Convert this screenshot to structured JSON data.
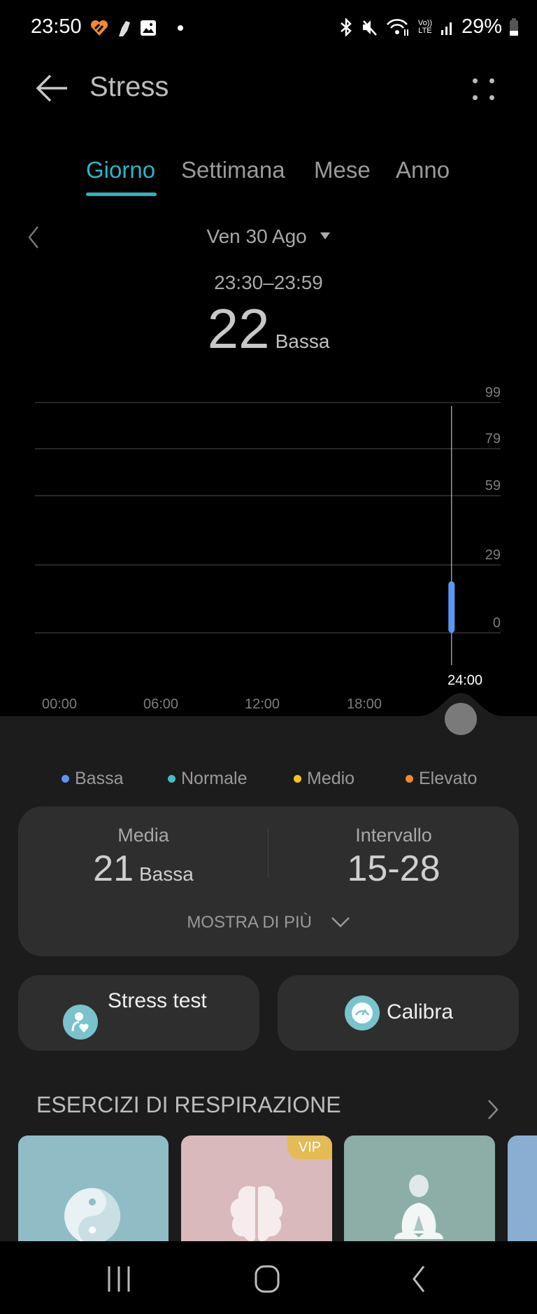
{
  "status_bar": {
    "time": "23:50",
    "battery": "29%",
    "left_icons": [
      "health-app-icon",
      "shoe-icon",
      "gallery-icon",
      "notification-dot-icon"
    ],
    "right_icons": [
      "bluetooth-icon",
      "mute-icon",
      "wifi-icon",
      "volte-icon",
      "signal-icon",
      "battery-icon"
    ],
    "volte_label": "Vo)) LTE"
  },
  "header": {
    "title": "Stress"
  },
  "tabs": [
    {
      "label": "Giorno",
      "active": true
    },
    {
      "label": "Settimana",
      "active": false
    },
    {
      "label": "Mese",
      "active": false
    },
    {
      "label": "Anno",
      "active": false
    }
  ],
  "date": {
    "label": "Ven 30 Ago"
  },
  "selection": {
    "time_range": "23:30–23:59",
    "value": "22",
    "level": "Bassa"
  },
  "chart_data": {
    "type": "bar",
    "title": "",
    "xlabel": "",
    "ylabel": "",
    "x_ticks": [
      "00:00",
      "06:00",
      "12:00",
      "18:00",
      "24:00"
    ],
    "y_ticks": [
      0,
      29,
      59,
      79,
      99
    ],
    "ylim": [
      0,
      99
    ],
    "xlim_hours": [
      0,
      24
    ],
    "grid": true,
    "selected_x_label": "24:00",
    "series": [
      {
        "name": "Stress",
        "color": "#5b95f5",
        "points": [
          {
            "x_hours": 23.5,
            "low": 0,
            "high": 22
          }
        ]
      }
    ]
  },
  "legend": [
    {
      "label": "Bassa",
      "color": "#5b95f5"
    },
    {
      "label": "Normale",
      "color": "#3fc0c4"
    },
    {
      "label": "Medio",
      "color": "#f5c518"
    },
    {
      "label": "Elevato",
      "color": "#f08a2c"
    }
  ],
  "summary": {
    "avg_label": "Media",
    "avg_value": "21",
    "avg_level": "Bassa",
    "range_label": "Intervallo",
    "range_value": "15-28",
    "more_label": "MOSTRA DI PIÙ"
  },
  "actions": {
    "stress_test": "Stress test",
    "calibrate": "Calibra"
  },
  "breathing": {
    "title": "ESERCIZI DI RESPIRAZIONE",
    "cards": [
      {
        "icon": "yin-yang-icon",
        "color": "#90bcc6",
        "vip": false
      },
      {
        "icon": "brain-icon",
        "color": "#d9b9bc",
        "vip": true,
        "badge": "VIP"
      },
      {
        "icon": "meditation-icon",
        "color": "#8caea7",
        "vip": false
      },
      {
        "icon": "partial-card",
        "color": "#89aed2",
        "vip": false
      }
    ]
  },
  "colors": {
    "accent": "#2bb5c2",
    "bar": "#5b95f5"
  }
}
